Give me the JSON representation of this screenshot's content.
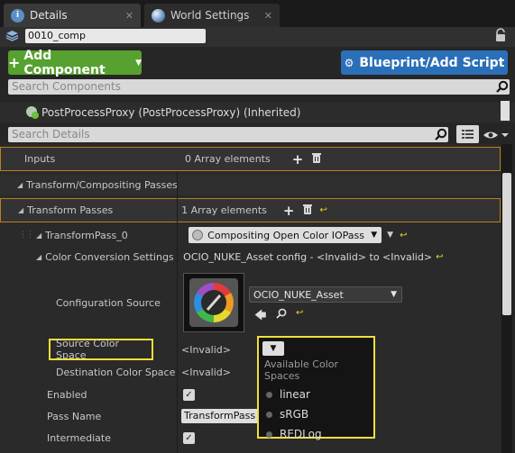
{
  "tabs": [
    {
      "label": "Details",
      "icon": "info-icon"
    },
    {
      "label": "World Settings",
      "icon": "globe-icon"
    }
  ],
  "actor_name": "0010_comp",
  "buttons": {
    "add_component": "Add Component",
    "blueprint": "Blueprint/Add Script"
  },
  "search": {
    "components_placeholder": "Search Components",
    "details_placeholder": "Search Details"
  },
  "component_row": "PostProcessProxy (PostProcessProxy) (Inherited)",
  "rows": {
    "inputs": {
      "label": "Inputs",
      "value": "0 Array elements"
    },
    "transform_compositing": {
      "label": "Transform/Compositing Passes"
    },
    "transform_passes": {
      "label": "Transform Passes",
      "value": "1 Array elements"
    },
    "transform_pass_0": {
      "label": "TransformPass_0",
      "value": "Compositing Open Color IOPass"
    },
    "color_conversion": {
      "label": "Color Conversion Settings",
      "value": "OCIO_NUKE_Asset config - <Invalid> to <Invalid>"
    },
    "config_source": {
      "label": "Configuration Source",
      "value": "OCIO_NUKE_Asset"
    },
    "source_color_space": {
      "label": "Source Color Space",
      "value": "<Invalid>"
    },
    "dest_color_space": {
      "label": "Destination Color Space",
      "value": "<Invalid>"
    },
    "enabled": {
      "label": "Enabled",
      "checked": true
    },
    "pass_name": {
      "label": "Pass Name",
      "value": "TransformPass"
    },
    "intermediate": {
      "label": "Intermediate",
      "checked": true
    }
  },
  "popup": {
    "title": "Available Color Spaces",
    "items": [
      "linear",
      "sRGB",
      "REDLog"
    ]
  },
  "colors": {
    "add_button": "#56a12f",
    "blueprint_button": "#2a6fb8",
    "highlight_orange": "#b8801f",
    "highlight_yellow": "#efe03a"
  }
}
